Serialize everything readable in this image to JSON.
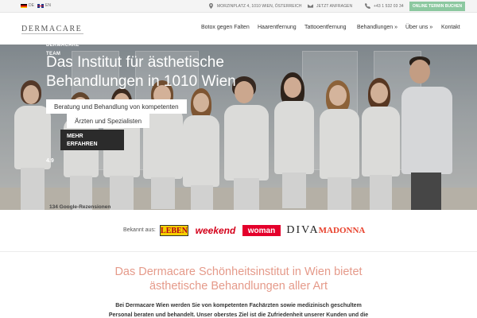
{
  "topbar": {
    "lang_de": "DE",
    "lang_en": "EN",
    "address": "MORZINPLATZ 4, 1010 WIEN, ÖSTERREICH",
    "address_icon": "location-pin-icon",
    "inquiry": "JETZT ANFRAGEN",
    "inquiry_icon": "envelope-icon",
    "phone": "+43 1 532 03 34",
    "phone_icon": "phone-icon",
    "cta": "ONLINE TERMIN BUCHEN"
  },
  "header": {
    "logo": "DERMACARE",
    "nav": [
      "Botox gegen Falten",
      "Haarentfernung",
      "Tattooentfernung",
      "Behandlungen »",
      "Über uns »",
      "Kontakt"
    ]
  },
  "hero": {
    "brand": "DERMACARE",
    "team": "TEAM",
    "title_line1": "Das Institut für ästhetische",
    "title_line2": "Behandlungen in 1010 Wien",
    "subtitle_line1": "Beratung und Behandlung von kompetenten",
    "subtitle_line2": "Ärzten und Spezialisten",
    "button_line1": "MEHR",
    "button_line2": "ERFAHREN",
    "rating": "4.9",
    "reviews": "134 Google-Rezensionen"
  },
  "press": {
    "label": "Bekannt aus:",
    "logos": [
      "LEBEN",
      "weekend",
      "woman",
      "DIVA",
      "MADONNA"
    ]
  },
  "intro": {
    "heading_line1": "Das Dermacare Schönheitsinstitut in Wien bietet",
    "heading_line2": "ästhetische Behandlungen aller Art",
    "text_line1": "Bei Dermacare Wien werden Sie von kompetenten Fachärzten sowie medizinisch geschultem",
    "text_line2": "Personal beraten und behandelt. Unser oberstes Ziel ist die Zufriedenheit unserer Kunden und die"
  },
  "colors": {
    "accent_green": "#8cc8a0",
    "heading_salmon": "#e59a8a",
    "button_dark": "#2b2b2b"
  }
}
